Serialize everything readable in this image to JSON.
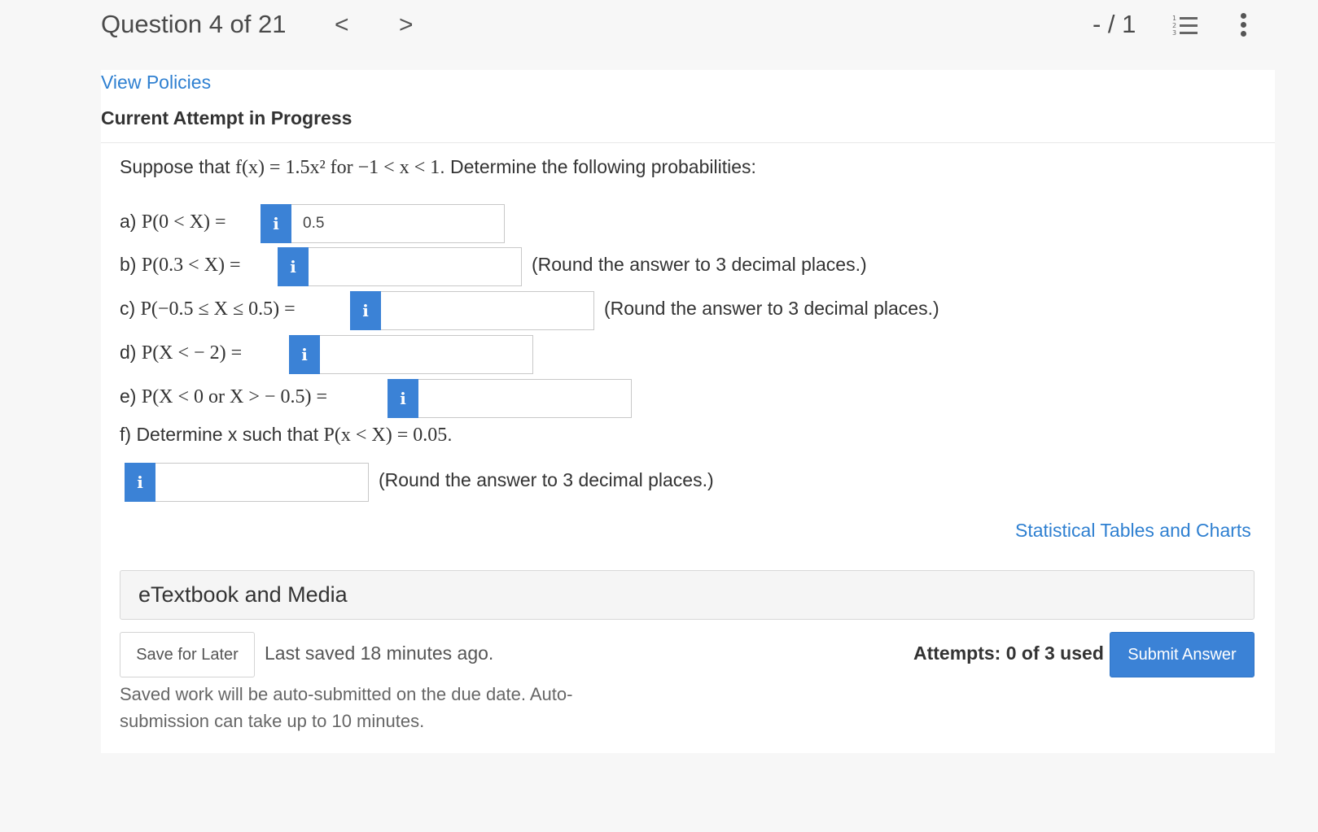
{
  "header": {
    "question_counter": "Question 4 of 21",
    "prev_glyph": "<",
    "next_glyph": ">",
    "score": "- / 1",
    "list_icon": "numbered-list-icon",
    "list_icon_numbers": [
      "1",
      "2",
      "3"
    ],
    "more_icon": "vertical-ellipsis-icon"
  },
  "card": {
    "view_policies": "View Policies",
    "attempt_heading": "Current Attempt in Progress"
  },
  "problem": {
    "prefix": "Suppose that ",
    "equation": "f(x) = 1.5x² for −1 < x < 1",
    "suffix": ". Determine the following probabilities:"
  },
  "questions": [
    {
      "label": "a) ",
      "expr": "P(0 < X) =",
      "value": "0.5",
      "hint": ""
    },
    {
      "label": "b) ",
      "expr": "P(0.3 < X) =",
      "value": "",
      "hint": "(Round the answer to 3 decimal places.)"
    },
    {
      "label": "c) ",
      "expr": "P(−0.5 ≤ X ≤ 0.5) =",
      "value": "",
      "hint": "(Round the answer to 3 decimal places.)"
    },
    {
      "label": "d) ",
      "expr": "P(X < − 2) =",
      "value": "",
      "hint": ""
    },
    {
      "label": "e) ",
      "expr": "P(X < 0 or X > − 0.5) =",
      "value": "",
      "hint": ""
    }
  ],
  "question_f": {
    "label": "f) Determine x such that ",
    "expr": "P(x < X) = 0.05",
    "period": ".",
    "value": "",
    "hint": "(Round the answer to 3 decimal places.)"
  },
  "info_glyph": "i",
  "links": {
    "statistical_tables": "Statistical Tables and Charts"
  },
  "etextbook": "eTextbook and Media",
  "footer": {
    "save_label": "Save for Later",
    "last_saved": "Last saved 18 minutes ago.",
    "autosubmit_note": "Saved work will be auto-submitted on the due date. Auto-submission can take up to 10 minutes.",
    "attempts": "Attempts: 0 of 3 used",
    "submit_label": "Submit Answer"
  },
  "colors": {
    "accent": "#3b82d6",
    "link": "#2f80d1"
  }
}
